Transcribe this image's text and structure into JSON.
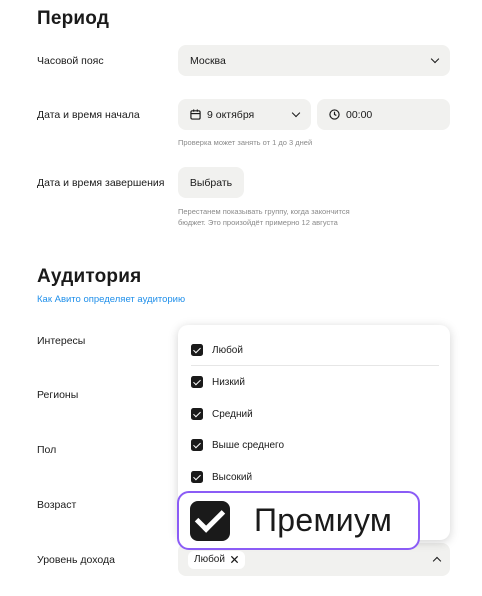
{
  "period": {
    "title": "Период",
    "timezone_label": "Часовой пояс",
    "timezone_value": "Москва",
    "start_label": "Дата и время начала",
    "start_date": "9 октября",
    "start_time": "00:00",
    "start_hint": "Проверка может занять от 1 до 3 дней",
    "end_label": "Дата и время завершения",
    "end_button": "Выбрать",
    "end_hint_line1": "Перестанем показывать группу, когда закончится",
    "end_hint_line2": "бюджет. Это произойдёт примерно 12 августа"
  },
  "audience": {
    "title": "Аудитория",
    "link": "Как Авито определяет аудиторию",
    "labels": {
      "interests": "Интересы",
      "regions": "Регионы",
      "gender": "Пол",
      "age": "Возраст",
      "income": "Уровень дохода"
    },
    "income_chip": "Любой",
    "dropdown_options": [
      "Любой",
      "Низкий",
      "Средний",
      "Выше среднего",
      "Высокий"
    ],
    "zoom_option": "Премиум"
  },
  "colors": {
    "accent_link": "#1f8fea",
    "highlight_border": "#8b5cf6",
    "field_bg": "#f1f1ef"
  }
}
